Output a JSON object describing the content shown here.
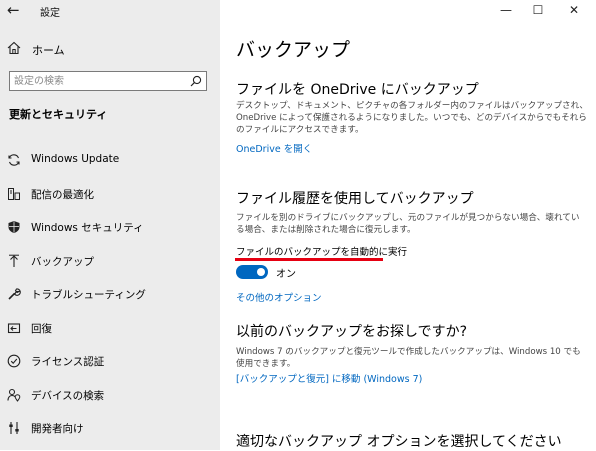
{
  "window": {
    "title": "設定",
    "minimize": "—",
    "maximize": "☐",
    "close": "✕"
  },
  "sidebar": {
    "home_label": "ホーム",
    "search_placeholder": "設定の検索",
    "section_title": "更新とセキュリティ",
    "items": [
      {
        "label": "Windows Update",
        "icon": "sync-icon"
      },
      {
        "label": "配信の最適化",
        "icon": "delivery-optimization-icon"
      },
      {
        "label": "Windows セキュリティ",
        "icon": "shield-icon"
      },
      {
        "label": "バックアップ",
        "icon": "upload-arrow-icon"
      },
      {
        "label": "トラブルシューティング",
        "icon": "wrench-icon"
      },
      {
        "label": "回復",
        "icon": "recovery-icon"
      },
      {
        "label": "ライセンス認証",
        "icon": "check-circle-icon"
      },
      {
        "label": "デバイスの検索",
        "icon": "person-location-icon"
      },
      {
        "label": "開発者向け",
        "icon": "developer-icon"
      }
    ]
  },
  "main": {
    "title": "バックアップ",
    "onedrive": {
      "heading": "ファイルを OneDrive にバックアップ",
      "description": "デスクトップ、ドキュメント、ピクチャの各フォルダー内のファイルはバックアップされ、OneDrive によって保護されるようになりました。いつでも、どのデバイスからでもそれらのファイルにアクセスできます。",
      "link": "OneDrive を開く"
    },
    "file_history": {
      "heading": "ファイル履歴を使用してバックアップ",
      "description": "ファイルを別のドライブにバックアップし、元のファイルが見つからない場合、壊れている場合、または削除された場合に復元します。",
      "toggle_label": "ファイルのバックアップを自動的に実行",
      "toggle_state": "オン",
      "toggle_on": true,
      "more_options_link": "その他のオプション"
    },
    "older_backup": {
      "heading": "以前のバックアップをお探しですか?",
      "description": "Windows 7 のバックアップと復元ツールで作成したバックアップは、Windows 10 でも使用できます。",
      "link": "[バックアップと復元] に移動 (Windows 7)"
    },
    "choose_option": {
      "heading": "適切なバックアップ オプションを選択してください"
    }
  },
  "colors": {
    "accent": "#0067c0",
    "highlight": "#e60012",
    "sidebar_bg": "#ececec"
  }
}
